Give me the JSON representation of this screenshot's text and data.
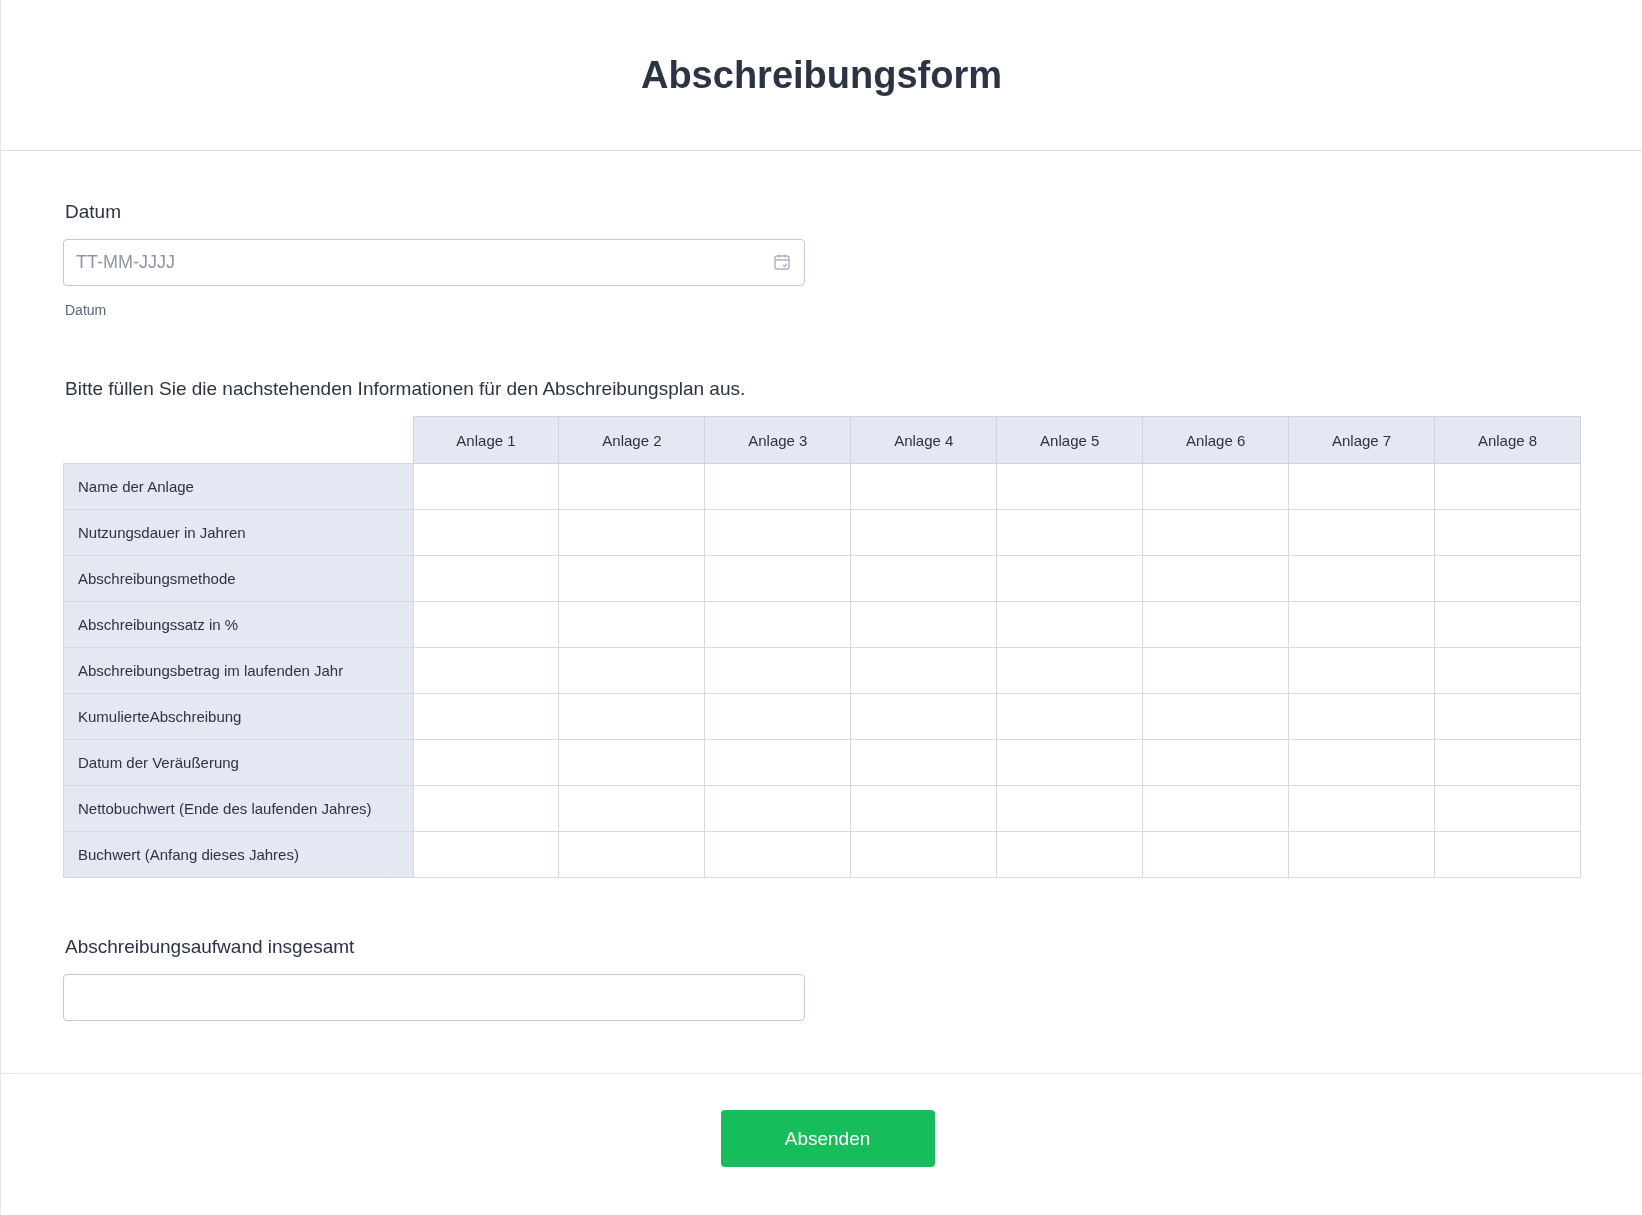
{
  "header": {
    "title": "Abschreibungsform"
  },
  "date_field": {
    "label": "Datum",
    "placeholder": "TT-MM-JJJJ",
    "sublabel": "Datum"
  },
  "table": {
    "instruction": "Bitte füllen Sie die nachstehenden Informationen für den Abschreibungsplan aus.",
    "columns": [
      "Anlage 1",
      "Anlage 2",
      "Anlage 3",
      "Anlage 4",
      "Anlage 5",
      "Anlage 6",
      "Anlage 7",
      "Anlage 8"
    ],
    "rows": [
      "Name der Anlage",
      "Nutzungsdauer in Jahren",
      "Abschreibungsmethode",
      "Abschreibungssatz in %",
      "Abschreibungsbetrag im laufenden Jahr",
      "KumulierteAbschreibung",
      "Datum der Veräußerung",
      "Nettobuchwert (Ende des laufenden Jahres)",
      "Buchwert (Anfang dieses Jahres)"
    ]
  },
  "total_field": {
    "label": "Abschreibungsaufwand insgesamt"
  },
  "submit_button": {
    "label": "Absenden"
  }
}
